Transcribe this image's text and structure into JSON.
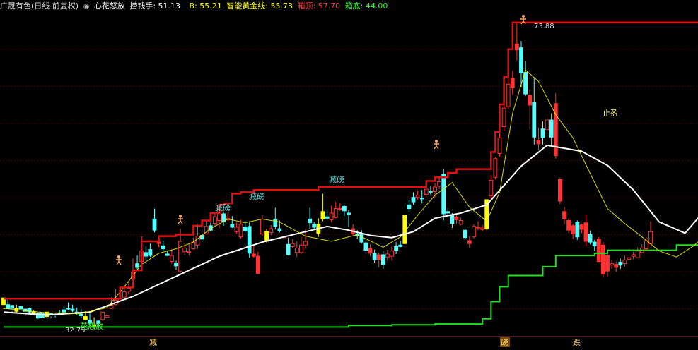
{
  "header": {
    "stock": "广晟有色(日线 前复权)",
    "indicator_icon": "circle-marker-icon",
    "indicator_name": "心花怒放",
    "items": [
      {
        "label": "捞钱手: 51.13",
        "color": "#ffffff"
      },
      {
        "label": "B: 55.21",
        "color": "#ffff00"
      },
      {
        "label": "智能黄金线: 55.73",
        "color": "#ffff00"
      },
      {
        "label": "箱顶: 57.70",
        "color": "#ff3333"
      },
      {
        "label": "箱底: 44.00",
        "color": "#33ff33"
      }
    ]
  },
  "annotations": {
    "high_label": "73.88",
    "low_label": "32.75",
    "bottom_text": "花怒放",
    "take_profit": "止盈",
    "reduce1": "减磅",
    "reduce2": "减磅",
    "reduce3": "减磅",
    "bottom_reduce": "减",
    "bottom_bang": "磅",
    "bottom_fall": "跌"
  },
  "chart_data": {
    "type": "candlestick",
    "high": 73.88,
    "low": 32.75,
    "colors": {
      "up": "#ff3333",
      "down": "#54ffff",
      "box_top": "#dd1111",
      "box_bottom": "#22dd22",
      "ma": "#ffffff",
      "gold": "#ffff00",
      "label": "#66dddd",
      "take_profit": "#ffff99"
    },
    "candles": [
      [
        36,
        36.9,
        35.5,
        35.4,
        "y"
      ],
      [
        36,
        35.5,
        36.9,
        35.4,
        "c"
      ],
      [
        35.5,
        35.9,
        35.1,
        35.0,
        "c"
      ],
      [
        35.5,
        35.1,
        36.0,
        34.9,
        "y"
      ],
      [
        35.4,
        35.8,
        35.0,
        34.9,
        "c"
      ],
      [
        35.4,
        35.1,
        35.9,
        34.8,
        "c"
      ],
      [
        35.5,
        35.0,
        35.6,
        34.9,
        "c"
      ],
      [
        35.0,
        34.8,
        35.3,
        34.6,
        "y"
      ],
      [
        34.8,
        34.2,
        34.9,
        34.1,
        "c"
      ],
      [
        34.9,
        34.3,
        34.5,
        34.2,
        "c"
      ],
      [
        35.0,
        34.4,
        34.7,
        34.3,
        "y"
      ],
      [
        34.8,
        34.6,
        34.4,
        34.2,
        "c"
      ],
      [
        34.6,
        34.7,
        34.5,
        34.3,
        "c"
      ],
      [
        34.8,
        34.9,
        35.2,
        34.6,
        "c"
      ],
      [
        35.0,
        35.3,
        35.7,
        34.9,
        "c"
      ],
      [
        35.4,
        35.5,
        36.3,
        35.2,
        "c"
      ],
      [
        35.2,
        35.4,
        36.0,
        35.0,
        "c"
      ],
      [
        34.8,
        35.0,
        35.6,
        34.6,
        "c"
      ],
      [
        34.5,
        34.7,
        35.4,
        34.2,
        "c"
      ],
      [
        34.0,
        34.4,
        35.1,
        33.9,
        "y"
      ],
      [
        33.5,
        33.9,
        34.8,
        33.3,
        "c"
      ],
      [
        33.0,
        33.3,
        34.3,
        32.7,
        "y"
      ],
      [
        33.8,
        33.5,
        33.9,
        32.9,
        "c"
      ],
      [
        34.0,
        35.0,
        35.0,
        33.8,
        "r"
      ],
      [
        34.3,
        34.5,
        36.5,
        34.2,
        "r"
      ],
      [
        35.5,
        35.9,
        37.0,
        35.4,
        "r"
      ],
      [
        36.0,
        36.6,
        38.1,
        35.9,
        "r"
      ],
      [
        36.5,
        36.8,
        37.5,
        36.4,
        "r"
      ],
      [
        37.0,
        37.7,
        38.6,
        36.9,
        "r"
      ],
      [
        37.8,
        38.2,
        39.0,
        37.4,
        "r"
      ],
      [
        39.5,
        40.4,
        42.2,
        39.2,
        "r"
      ],
      [
        41.0,
        41.5,
        42.6,
        40.6,
        "c"
      ],
      [
        41.8,
        43.2,
        45.2,
        41.7,
        "r"
      ],
      [
        43.0,
        42.5,
        43.8,
        41.9,
        "c"
      ],
      [
        42.6,
        43.4,
        44.2,
        42.4,
        "c"
      ],
      [
        47.5,
        46.0,
        48.9,
        45.7,
        "c"
      ],
      [
        44.4,
        44.2,
        45.0,
        43.7,
        "r"
      ],
      [
        43.5,
        43.9,
        44.6,
        43.2,
        "c"
      ],
      [
        42.8,
        42.6,
        43.3,
        42.5,
        "c"
      ],
      [
        41.8,
        42.6,
        43.4,
        41.5,
        "r"
      ],
      [
        41.6,
        41.2,
        41.9,
        40.7,
        "c"
      ],
      [
        40.5,
        44.5,
        46.2,
        40.4,
        "r"
      ],
      [
        43.1,
        43.6,
        44.3,
        42.7,
        "r"
      ],
      [
        43.0,
        43.1,
        44.2,
        42.6,
        "r"
      ],
      [
        43.5,
        44.4,
        45.0,
        43.4,
        "r"
      ],
      [
        44.0,
        45.2,
        46.8,
        43.5,
        "r"
      ],
      [
        45.3,
        44.8,
        46.2,
        44.6,
        "c"
      ],
      [
        45.5,
        46.5,
        47.3,
        45.4,
        "r"
      ],
      [
        46.6,
        46.0,
        47.0,
        45.8,
        "c"
      ],
      [
        46.9,
        47.8,
        48.4,
        46.6,
        "r"
      ],
      [
        47.3,
        48.8,
        49.5,
        46.3,
        "r"
      ],
      [
        48.2,
        47.1,
        48.5,
        46.6,
        "c"
      ],
      [
        47.4,
        47.6,
        48.4,
        47.2,
        "r"
      ],
      [
        46.8,
        46.4,
        47.9,
        46.3,
        "c"
      ],
      [
        45.8,
        46.4,
        47.0,
        45.5,
        "r"
      ],
      [
        45.1,
        46.8,
        47.4,
        44.9,
        "r"
      ],
      [
        45.9,
        46.4,
        47.2,
        45.7,
        "c"
      ],
      [
        46.5,
        42.9,
        47.2,
        42.3,
        "c"
      ],
      [
        42.8,
        42.5,
        43.9,
        42.3,
        "r"
      ],
      [
        42.5,
        40.2,
        43.1,
        40.1,
        "r"
      ],
      [
        45.5,
        47.5,
        48.0,
        45.2,
        "r"
      ],
      [
        44.5,
        45.8,
        46.2,
        44.3,
        "y"
      ],
      [
        45.7,
        46.2,
        46.7,
        45.3,
        "r"
      ],
      [
        46.5,
        47.5,
        49.0,
        46.1,
        "c"
      ],
      [
        45.9,
        46.2,
        47.3,
        45.7,
        "c"
      ],
      [
        45.0,
        45.1,
        45.9,
        44.7,
        "r"
      ],
      [
        44.1,
        42.7,
        45.0,
        42.6,
        "c"
      ],
      [
        43.8,
        44.2,
        44.8,
        43.6,
        "r"
      ],
      [
        43.0,
        43.6,
        44.5,
        42.4,
        "r"
      ],
      [
        43.0,
        44.0,
        45.1,
        42.8,
        "r"
      ],
      [
        44.0,
        44.5,
        46.2,
        43.5,
        "r"
      ],
      [
        47.0,
        47.5,
        49.0,
        46.2,
        "c"
      ],
      [
        46.8,
        46.4,
        47.1,
        46.1,
        "c"
      ],
      [
        45.6,
        46.8,
        47.6,
        45.1,
        "y"
      ],
      [
        47.5,
        48.5,
        50.9,
        47.2,
        "y"
      ],
      [
        47.8,
        47.6,
        48.7,
        47.3,
        "c"
      ],
      [
        47.4,
        48.3,
        49.3,
        47.1,
        "r"
      ],
      [
        47.7,
        48.9,
        49.8,
        47.6,
        "r"
      ],
      [
        48.8,
        48.9,
        49.6,
        48.6,
        "r"
      ],
      [
        49.2,
        48.6,
        49.4,
        47.9,
        "c"
      ],
      [
        48.3,
        48.1,
        48.7,
        46.4,
        "c"
      ],
      [
        46.2,
        45.5,
        46.8,
        45.3,
        "r"
      ],
      [
        45.5,
        45.3,
        46.0,
        44.8,
        "c"
      ],
      [
        45.5,
        44.4,
        46.0,
        44.2,
        "c"
      ],
      [
        44.3,
        43.3,
        44.7,
        42.8,
        "c"
      ],
      [
        43.6,
        42.9,
        44.1,
        42.5,
        "r"
      ],
      [
        42.9,
        42.0,
        43.4,
        41.6,
        "c"
      ],
      [
        42.7,
        42.0,
        43.0,
        41.0,
        "r"
      ],
      [
        41.4,
        42.7,
        43.2,
        40.8,
        "c"
      ],
      [
        42.4,
        42.8,
        43.4,
        41.9,
        "r"
      ],
      [
        42.5,
        43.2,
        43.8,
        41.9,
        "r"
      ],
      [
        43.3,
        43.8,
        44.4,
        42.8,
        "c"
      ],
      [
        43.8,
        44.0,
        44.6,
        43.7,
        "c"
      ],
      [
        44.2,
        48.0,
        48.1,
        44.1,
        "y"
      ],
      [
        48.9,
        49.4,
        50.0,
        48.4,
        "c"
      ],
      [
        49.8,
        50.4,
        51.1,
        49.4,
        "c"
      ],
      [
        50.4,
        50.7,
        51.3,
        50.1,
        "r"
      ],
      [
        50.2,
        50.3,
        51.4,
        49.6,
        "c"
      ],
      [
        50.8,
        51.5,
        52.5,
        50.6,
        "r"
      ],
      [
        51.2,
        51.1,
        51.9,
        50.8,
        "c"
      ],
      [
        51.2,
        51.8,
        52.3,
        50.4,
        "r"
      ],
      [
        51.9,
        52.5,
        53.1,
        51.5,
        "r"
      ],
      [
        53.5,
        48.2,
        54.2,
        47.3,
        "c"
      ],
      [
        48.5,
        48.3,
        48.9,
        48.1,
        "c"
      ],
      [
        48.1,
        46.9,
        48.3,
        46.3,
        "c"
      ],
      [
        47.8,
        47.4,
        48.0,
        46.8,
        "r"
      ],
      [
        46.8,
        47.3,
        47.7,
        46.7,
        "r"
      ],
      [
        46.0,
        45.0,
        46.2,
        44.8,
        "c"
      ],
      [
        44.6,
        44.2,
        45.2,
        43.6,
        "r"
      ],
      [
        45.1,
        46.5,
        46.8,
        44.9,
        "r"
      ],
      [
        46.4,
        46.3,
        47.2,
        46.0,
        "r"
      ],
      [
        46.1,
        46.3,
        46.7,
        45.8,
        "r"
      ],
      [
        46.2,
        50.1,
        50.1,
        46.0,
        "y"
      ],
      [
        50.6,
        52.7,
        53.4,
        50.2,
        "r"
      ],
      [
        53.1,
        55.6,
        55.8,
        52.8,
        "r"
      ],
      [
        56.3,
        58.4,
        59.0,
        55.9,
        "r"
      ],
      [
        59.9,
        62.4,
        63.2,
        59.3,
        "r"
      ],
      [
        62.6,
        65.6,
        67.0,
        62.3,
        "r"
      ],
      [
        66.4,
        65.1,
        67.4,
        64.2,
        "r"
      ],
      [
        71.0,
        70.2,
        73.9,
        68.8,
        "r"
      ],
      [
        70.5,
        67.1,
        71.4,
        65.2,
        "c"
      ],
      [
        67.2,
        64.3,
        68.7,
        64.0,
        "c"
      ],
      [
        64.1,
        62.8,
        64.9,
        59.6,
        "r"
      ],
      [
        63.2,
        58.5,
        66.5,
        57.5,
        "c"
      ],
      [
        58.1,
        57.6,
        59.8,
        56.7,
        "r"
      ],
      [
        58.4,
        59.6,
        60.6,
        57.5,
        "c"
      ],
      [
        59.5,
        60.8,
        61.2,
        58.9,
        "r"
      ],
      [
        60.8,
        58.5,
        61.7,
        57.3,
        "c"
      ],
      [
        63.0,
        56.0,
        64.4,
        55.6,
        "r"
      ],
      [
        52.8,
        49.9,
        53.0,
        49.5,
        "r"
      ],
      [
        48.5,
        47.5,
        49.1,
        46.8,
        "r"
      ],
      [
        47.3,
        46.0,
        47.6,
        45.6,
        "r"
      ],
      [
        46.6,
        45.5,
        46.9,
        44.8,
        "r"
      ],
      [
        45.1,
        47.1,
        47.3,
        44.7,
        "c"
      ],
      [
        46.7,
        46.1,
        46.9,
        45.6,
        "r"
      ],
      [
        47.0,
        44.5,
        48.1,
        43.8,
        "r"
      ],
      [
        45.4,
        44.4,
        45.9,
        44.1,
        "c"
      ],
      [
        43.9,
        44.4,
        44.7,
        43.2,
        "c"
      ],
      [
        44.8,
        41.8,
        45.1,
        41.7,
        "r"
      ],
      [
        44.0,
        40.1,
        44.4,
        39.7,
        "r"
      ],
      [
        42.6,
        40.5,
        42.8,
        39.8,
        "r"
      ],
      [
        41.3,
        41.5,
        42.0,
        40.8,
        "r"
      ],
      [
        41.4,
        41.0,
        41.8,
        40.4,
        "r"
      ],
      [
        41.3,
        41.7,
        42.2,
        40.8,
        "c"
      ],
      [
        41.5,
        42.0,
        42.6,
        41.1,
        "r"
      ],
      [
        42.1,
        42.3,
        42.7,
        41.8,
        "r"
      ],
      [
        42.5,
        42.7,
        43.1,
        42.1,
        "r"
      ],
      [
        42.3,
        43.2,
        43.7,
        42.2,
        "r"
      ],
      [
        43.0,
        43.6,
        44.1,
        42.9,
        "r"
      ],
      [
        43.5,
        44.6,
        45.1,
        43.3,
        "r"
      ],
      [
        44.2,
        45.8,
        47.2,
        44.1,
        "r"
      ]
    ],
    "box_top": [
      [
        0,
        36.8
      ],
      [
        24,
        36.8
      ],
      [
        27,
        38.3
      ],
      [
        30,
        40.6
      ],
      [
        32,
        44.5
      ],
      [
        36,
        45.2
      ],
      [
        40,
        45.4
      ],
      [
        44,
        46.6
      ],
      [
        46,
        47.3
      ],
      [
        48,
        48.3
      ],
      [
        50,
        49.4
      ],
      [
        51,
        49.6
      ],
      [
        52,
        49.6
      ],
      [
        53,
        50.9
      ],
      [
        54,
        50.9
      ],
      [
        55,
        51.1
      ],
      [
        56,
        51.1
      ],
      [
        58,
        51.4
      ],
      [
        60,
        51.4
      ],
      [
        62,
        51.4
      ],
      [
        71,
        51.4
      ],
      [
        73,
        51.8
      ],
      [
        80,
        51.8
      ],
      [
        90,
        51.8
      ],
      [
        96,
        51.8
      ],
      [
        98,
        52.6
      ],
      [
        100,
        53.1
      ],
      [
        103,
        53.7
      ],
      [
        105,
        54.2
      ],
      [
        108,
        54.2
      ],
      [
        112,
        54.2
      ],
      [
        113,
        56.5
      ],
      [
        114,
        59.2
      ],
      [
        115,
        62.9
      ],
      [
        116,
        66.6
      ],
      [
        117,
        70.3
      ],
      [
        118,
        73.9
      ],
      [
        162,
        73.9
      ]
    ],
    "box_bottom": [
      [
        0,
        33.0
      ],
      [
        80,
        33.2
      ],
      [
        90,
        33.3
      ],
      [
        100,
        33.4
      ],
      [
        110,
        33.4
      ],
      [
        111,
        34.1
      ],
      [
        113,
        36.4
      ],
      [
        115,
        38.4
      ],
      [
        117,
        39.9
      ],
      [
        122,
        39.9
      ],
      [
        125,
        41.1
      ],
      [
        128,
        42.6
      ],
      [
        133,
        42.6
      ],
      [
        137,
        42.9
      ],
      [
        140,
        43.3
      ],
      [
        153,
        43.3
      ],
      [
        156,
        44.0
      ],
      [
        162,
        44.0
      ]
    ],
    "ma": [
      [
        0,
        35.0
      ],
      [
        10,
        34.6
      ],
      [
        20,
        35.0
      ],
      [
        30,
        37.1
      ],
      [
        40,
        39.8
      ],
      [
        50,
        42.5
      ],
      [
        60,
        44.4
      ],
      [
        70,
        45.8
      ],
      [
        75,
        46.5
      ],
      [
        80,
        46.0
      ],
      [
        85,
        45.3
      ],
      [
        90,
        45.0
      ],
      [
        95,
        45.8
      ],
      [
        100,
        47.6
      ],
      [
        106,
        48.3
      ],
      [
        112,
        49.4
      ],
      [
        116,
        52.0
      ],
      [
        120,
        54.6
      ],
      [
        126,
        57.4
      ],
      [
        130,
        57.0
      ],
      [
        134,
        56.6
      ],
      [
        140,
        54.7
      ],
      [
        146,
        51.4
      ],
      [
        152,
        47.1
      ],
      [
        158,
        45.6
      ],
      [
        162,
        48.3
      ]
    ],
    "gold": [
      [
        0,
        35.5
      ],
      [
        10,
        34.9
      ],
      [
        18,
        34.8
      ],
      [
        24,
        35.6
      ],
      [
        28,
        38.4
      ],
      [
        32,
        41.4
      ],
      [
        36,
        42.9
      ],
      [
        40,
        43.5
      ],
      [
        44,
        44.4
      ],
      [
        48,
        46.2
      ],
      [
        52,
        47.5
      ],
      [
        56,
        47.0
      ],
      [
        60,
        47.5
      ],
      [
        64,
        47.1
      ],
      [
        70,
        45.2
      ],
      [
        76,
        44.5
      ],
      [
        82,
        45.4
      ],
      [
        88,
        43.7
      ],
      [
        92,
        45.1
      ],
      [
        96,
        48.0
      ],
      [
        100,
        50.7
      ],
      [
        104,
        52.4
      ],
      [
        108,
        49.1
      ],
      [
        112,
        47.2
      ],
      [
        115,
        51.1
      ],
      [
        118,
        61.7
      ],
      [
        121,
        67.5
      ],
      [
        124,
        66.0
      ],
      [
        128,
        61.5
      ],
      [
        132,
        58.4
      ],
      [
        136,
        53.6
      ],
      [
        140,
        48.9
      ],
      [
        144,
        46.9
      ],
      [
        148,
        45.1
      ],
      [
        152,
        43.2
      ],
      [
        156,
        42.4
      ],
      [
        160,
        43.9
      ],
      [
        162,
        45.0
      ]
    ]
  }
}
